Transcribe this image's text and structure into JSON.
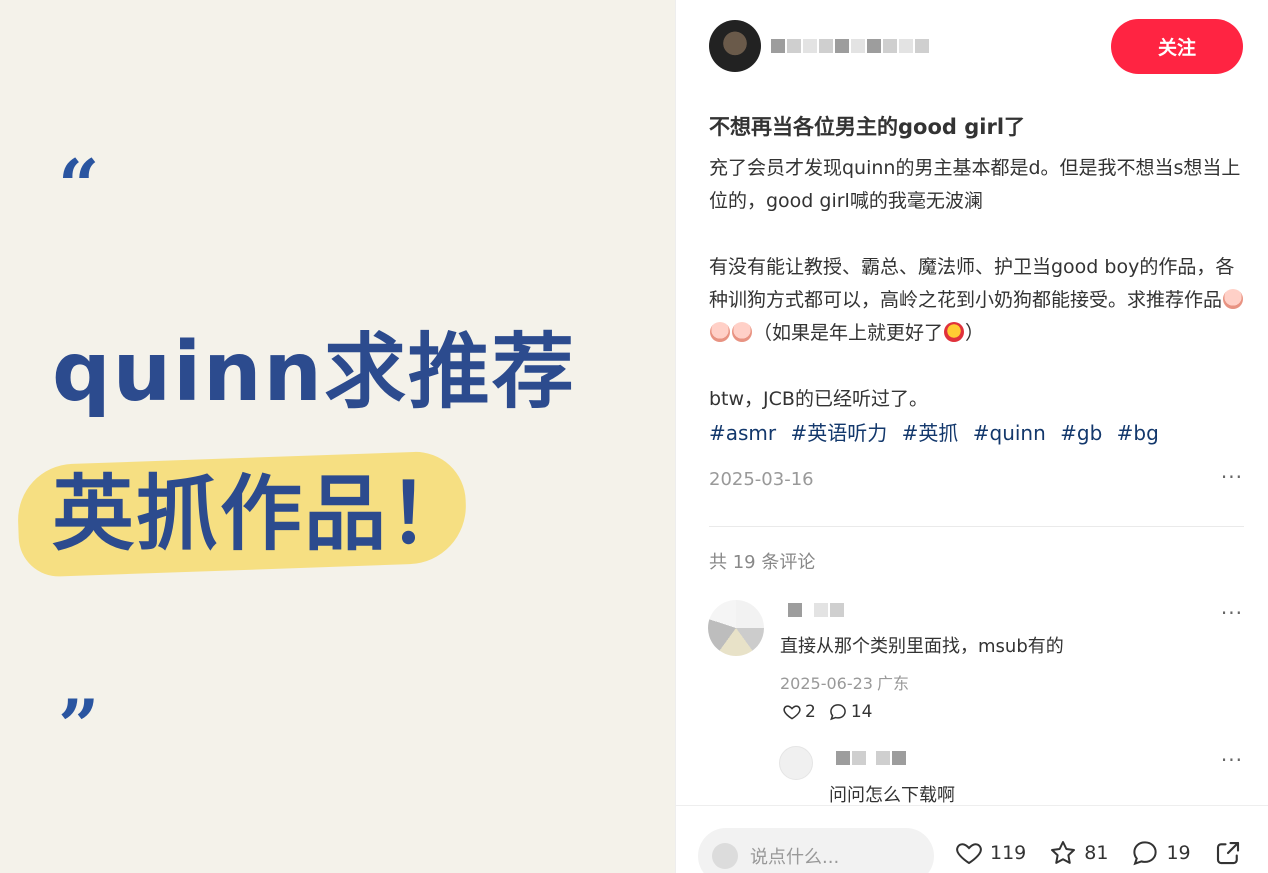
{
  "cover": {
    "open_quote": "“",
    "close_quote": "”",
    "line1": "quinn求推荐",
    "line2": "英抓作品！"
  },
  "author": {
    "follow_label": "关注"
  },
  "note": {
    "title": "不想再当各位男主的good girl了",
    "para1": "充了会员才发现quinn的男主基本都是d。但是我不想当s想当上位的，good girl喊的我毫无波澜",
    "para2_before": "有没有能让教授、霸总、魔法师、护卫当good boy的作品，各种训狗方式都可以，高岭之花到小奶狗都能接受。求推荐作品",
    "para2_middle": "（如果是年上就更好了",
    "para2_after": "）",
    "para3": "btw，JCB的已经听过了。",
    "tags": [
      "#asmr",
      "#英语听力",
      "#英抓",
      "#quinn",
      "#gb",
      "#bg"
    ],
    "date": "2025-03-16"
  },
  "comments": {
    "count_label": "共 19 条评论",
    "items": [
      {
        "text": "直接从那个类别里面找，msub有的",
        "date": "2025-06-23",
        "location": "广东",
        "likes": "2",
        "replies": "14"
      }
    ],
    "reply": {
      "text": "问问怎么下载啊"
    }
  },
  "bottom_bar": {
    "placeholder": "说点什么...",
    "likes": "119",
    "collects": "81",
    "comments": "19"
  },
  "colors": {
    "accent": "#ff2442",
    "tag": "#13386c",
    "cover_bg": "#f4f2ea",
    "cover_text": "#2c4b8e",
    "cover_highlight": "#f6df82"
  }
}
